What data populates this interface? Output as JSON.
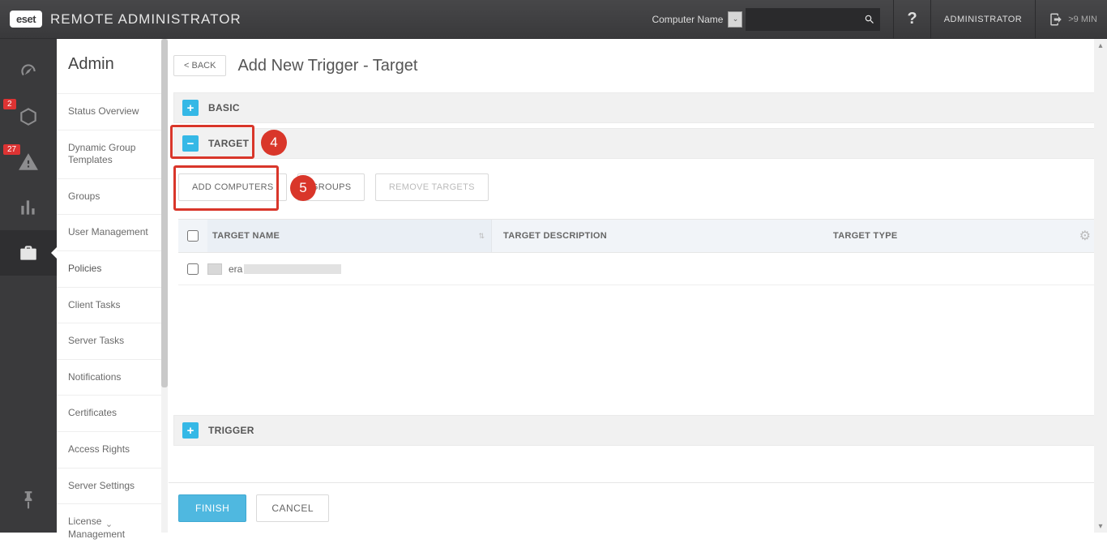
{
  "topbar": {
    "logo": "eset",
    "product": "REMOTE ADMINISTRATOR",
    "search_label": "Computer Name",
    "search_value": "",
    "help": "?",
    "user": "ADMINISTRATOR",
    "session": ">9 MIN"
  },
  "rail": {
    "badges": {
      "cube": "2",
      "alert": "27"
    }
  },
  "submenu": {
    "title": "Admin",
    "items": [
      "Status Overview",
      "Dynamic Group Templates",
      "Groups",
      "User Management",
      "Policies",
      "Client Tasks",
      "Server Tasks",
      "Notifications",
      "Certificates",
      "Access Rights",
      "Server Settings",
      "License Management"
    ]
  },
  "page": {
    "back": "< BACK",
    "title": "Add New Trigger - Target"
  },
  "sections": {
    "basic": "BASIC",
    "target": "TARGET",
    "trigger": "TRIGGER"
  },
  "buttons": {
    "add_computers": "ADD COMPUTERS",
    "add_groups": "GROUPS",
    "remove_targets": "REMOVE TARGETS"
  },
  "table": {
    "col_name": "TARGET NAME",
    "col_desc": "TARGET DESCRIPTION",
    "col_type": "TARGET TYPE",
    "rows": [
      {
        "name": "era"
      }
    ]
  },
  "footer": {
    "finish": "FINISH",
    "cancel": "CANCEL"
  },
  "annotations": {
    "four": "4",
    "five": "5"
  }
}
